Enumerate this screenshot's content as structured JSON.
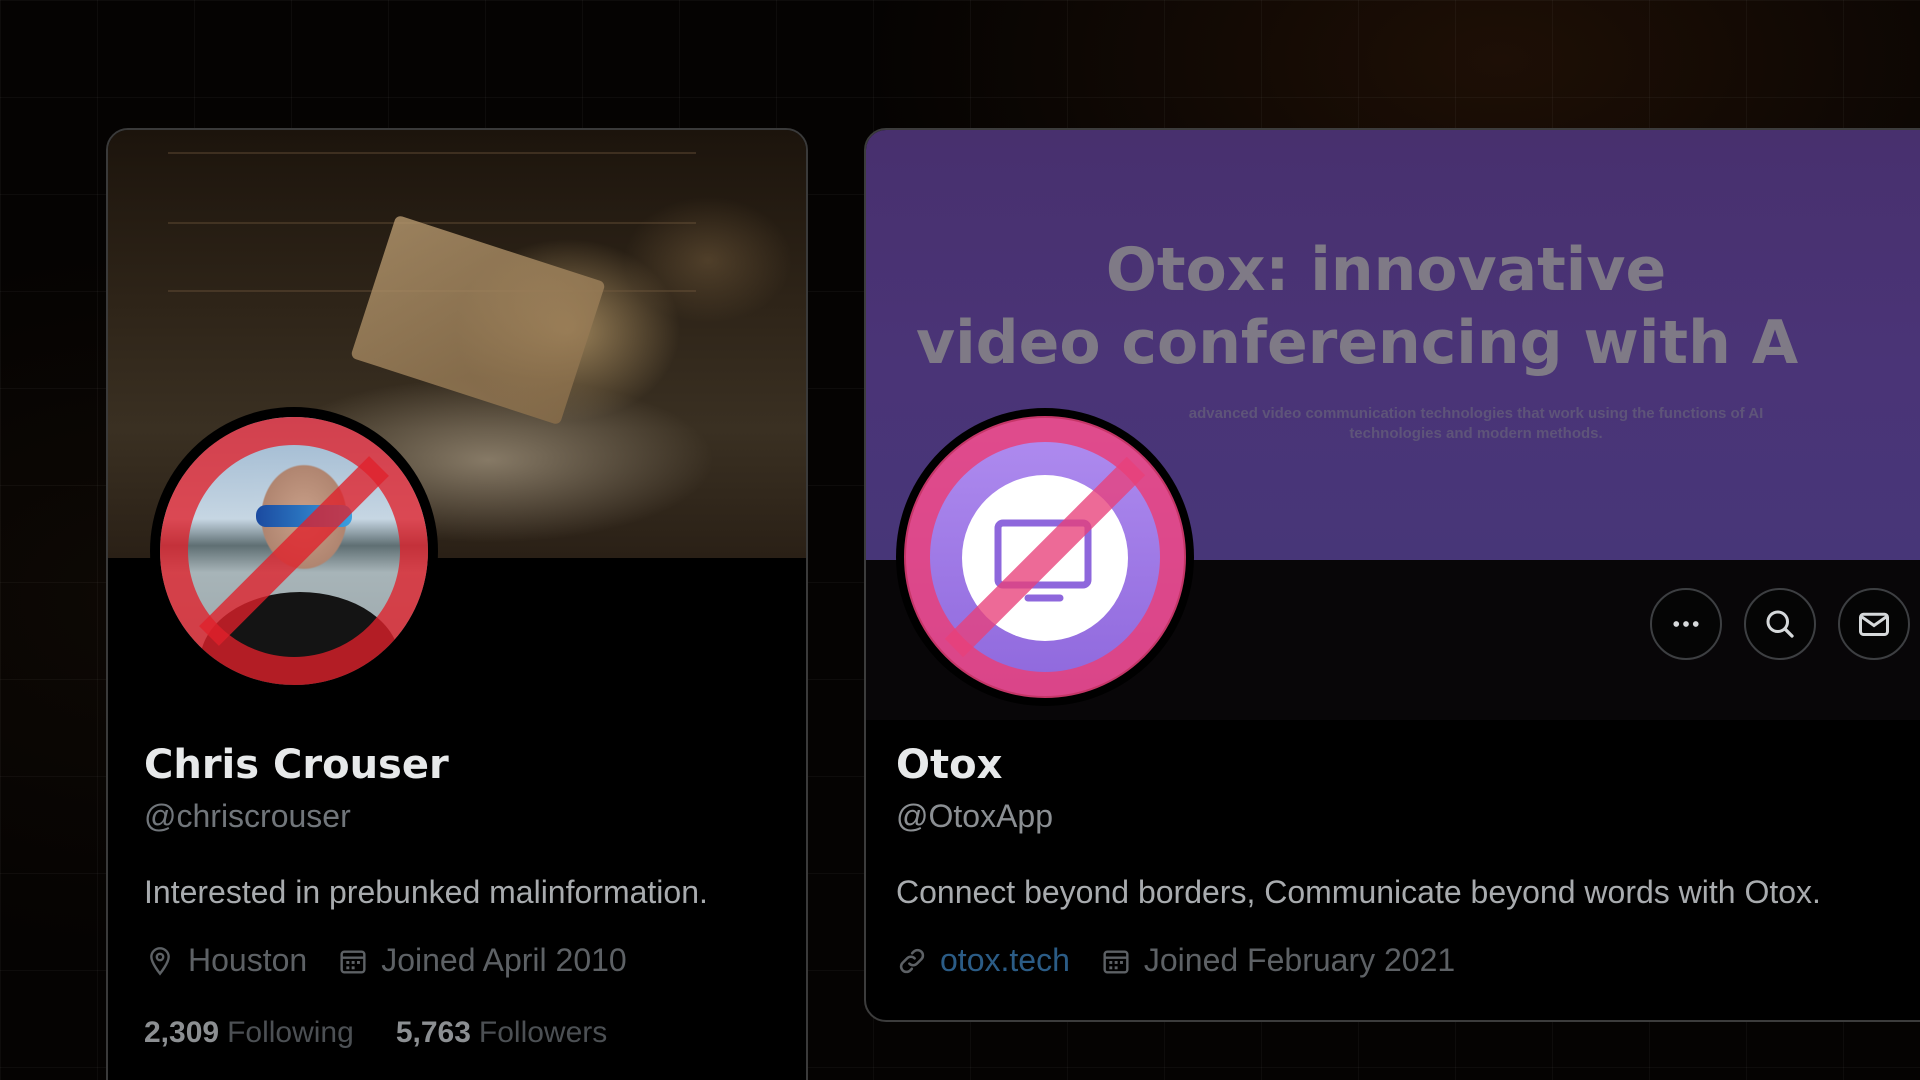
{
  "profiles": [
    {
      "name": "Chris Crouser",
      "handle": "@chriscrouser",
      "bio": "Interested in prebunked malinformation.",
      "location": "Houston",
      "joined": "Joined April 2010",
      "following_count": "2,309",
      "following_label": "Following",
      "followers_count": "5,763",
      "followers_label": "Followers",
      "avatar_blocked": true,
      "no_sign_color": "#e0202a"
    },
    {
      "name": "Otox",
      "handle": "@OtoxApp",
      "bio": "Connect beyond borders, Communicate beyond words with Otox.",
      "website": "otox.tech",
      "joined": "Joined February 2021",
      "banner_headline_line1": "Otox: innovative",
      "banner_headline_line2": "video conferencing with A",
      "banner_tagline_line1": "advanced video communication technologies that work using the functions of AI",
      "banner_tagline_line2": "technologies and modern methods.",
      "avatar_blocked": true,
      "no_sign_color": "#e8407a",
      "accent_color": "#a077e8",
      "actions": [
        "more-icon",
        "search-icon",
        "message-icon"
      ]
    }
  ]
}
